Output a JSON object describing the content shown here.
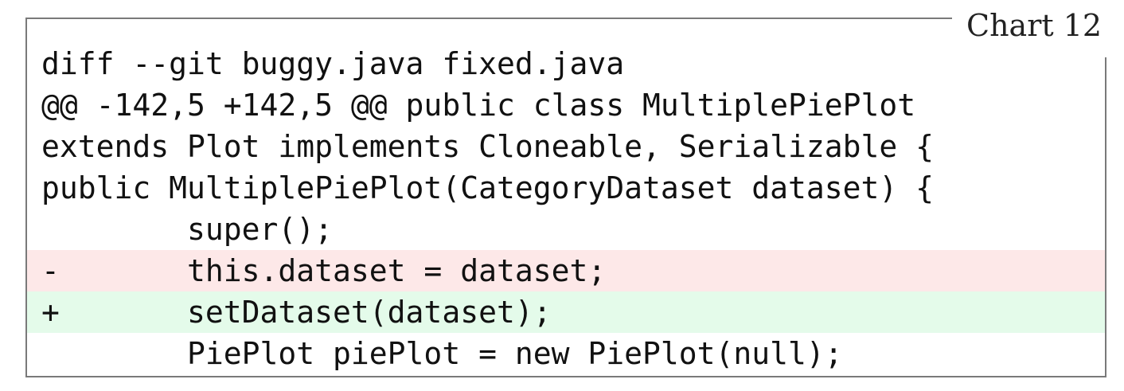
{
  "label": "Chart 12",
  "diff": {
    "lines": [
      {
        "type": "context",
        "text": "diff --git buggy.java fixed.java"
      },
      {
        "type": "context",
        "text": "@@ -142,5 +142,5 @@ public class MultiplePiePlot"
      },
      {
        "type": "context",
        "text": "extends Plot implements Cloneable, Serializable {"
      },
      {
        "type": "context",
        "text": "public MultiplePiePlot(CategoryDataset dataset) {"
      },
      {
        "type": "context",
        "text": "        super();"
      },
      {
        "type": "removed",
        "text": "-       this.dataset = dataset;"
      },
      {
        "type": "added",
        "text": "+       setDataset(dataset);"
      },
      {
        "type": "context",
        "text": "        PiePlot piePlot = new PiePlot(null);"
      }
    ]
  }
}
